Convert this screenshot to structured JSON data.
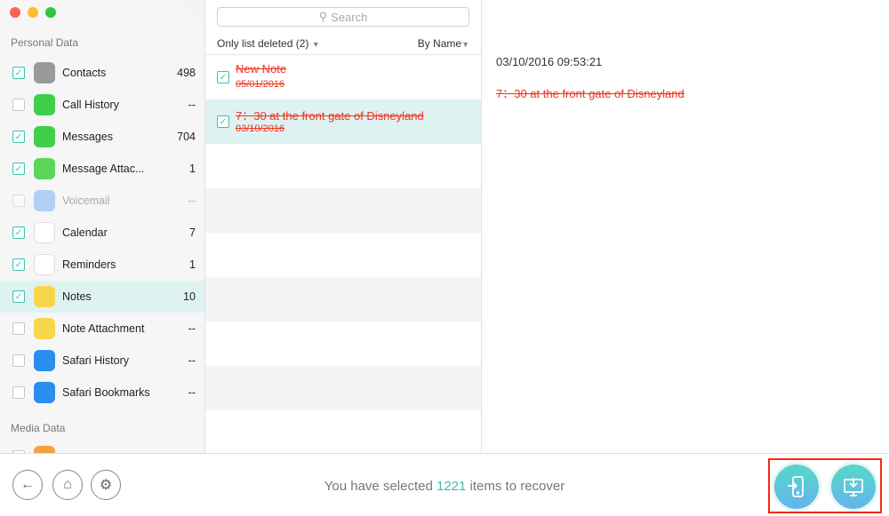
{
  "sidebar": {
    "personal_title": "Personal Data",
    "media_title": "Media Data",
    "items": [
      {
        "label": "Contacts",
        "count": "498",
        "checked": true,
        "icon": "contacts-icon",
        "color": "#9a9a9a"
      },
      {
        "label": "Call History",
        "count": "--",
        "checked": false,
        "icon": "phone-icon",
        "color": "#3fcf4a"
      },
      {
        "label": "Messages",
        "count": "704",
        "checked": true,
        "icon": "messages-icon",
        "color": "#3fcf4a"
      },
      {
        "label": "Message Attac...",
        "count": "1",
        "checked": true,
        "icon": "message-attachment-icon",
        "color": "#5ad65a"
      },
      {
        "label": "Voicemail",
        "count": "--",
        "checked": false,
        "icon": "voicemail-icon",
        "color": "#6aa8f0",
        "disabled": true
      },
      {
        "label": "Calendar",
        "count": "7",
        "checked": true,
        "icon": "calendar-icon",
        "color": "#ffffff"
      },
      {
        "label": "Reminders",
        "count": "1",
        "checked": true,
        "icon": "reminders-icon",
        "color": "#ffffff"
      },
      {
        "label": "Notes",
        "count": "10",
        "checked": true,
        "icon": "notes-icon",
        "color": "#f8d64a",
        "selected": true
      },
      {
        "label": "Note Attachment",
        "count": "--",
        "checked": false,
        "icon": "note-attachment-icon",
        "color": "#f8d64a"
      },
      {
        "label": "Safari History",
        "count": "--",
        "checked": false,
        "icon": "safari-history-icon",
        "color": "#2a8ef0"
      },
      {
        "label": "Safari Bookmarks",
        "count": "--",
        "checked": false,
        "icon": "safari-bookmarks-icon",
        "color": "#2a8ef0"
      }
    ]
  },
  "list": {
    "search_placeholder": "Search",
    "filter": "Only list deleted (2)",
    "sort": "By Name",
    "notes": [
      {
        "title": "New Note",
        "date": "05/01/2016",
        "checked": true
      },
      {
        "title": "7：30 at the front gate of Disneyland",
        "date": "03/10/2016",
        "checked": true,
        "selected": true
      }
    ]
  },
  "detail": {
    "datetime": "03/10/2016 09:53:21",
    "content": "7：30 at the front gate of Disneyland"
  },
  "bottom": {
    "status_prefix": "You have selected",
    "count": "1221",
    "status_suffix": "items to recover"
  },
  "colors": {
    "accent": "#3cc2b4",
    "deleted": "#f0321e",
    "highlight": "#f02a1a"
  }
}
